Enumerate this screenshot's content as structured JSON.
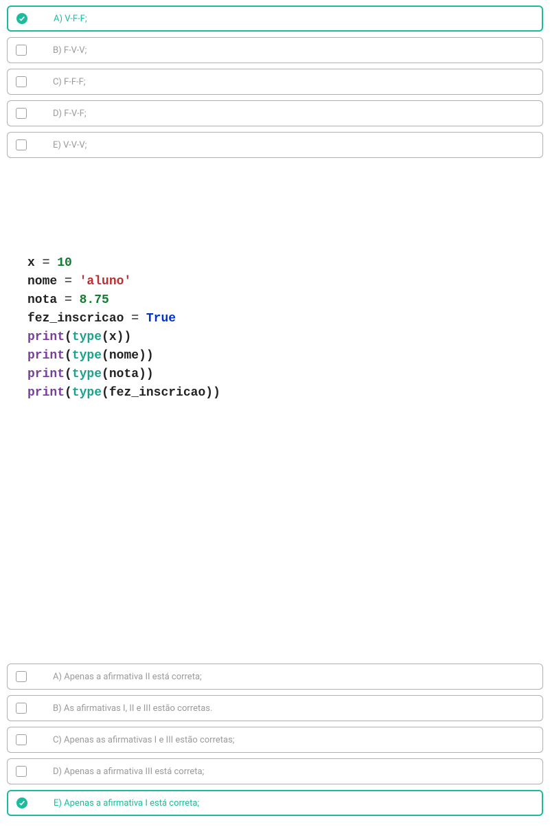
{
  "question1": {
    "options": [
      {
        "label": "A) V-F-F;",
        "selected": true
      },
      {
        "label": "B) F-V-V;",
        "selected": false
      },
      {
        "label": "C) F-F-F;",
        "selected": false
      },
      {
        "label": "D) F-V-F;",
        "selected": false
      },
      {
        "label": "E) V-V-V;",
        "selected": false
      }
    ]
  },
  "code": {
    "line1_var": "x",
    "line1_op": " = ",
    "line1_val": "10",
    "line2_var": "nome",
    "line2_op": " = ",
    "line2_val": "'aluno'",
    "line3_var": "nota",
    "line3_op": " = ",
    "line3_val": "8.75",
    "line4_var": "fez_inscricao",
    "line4_op": " = ",
    "line4_val": "True",
    "print": "print",
    "type": "type",
    "lp": "(",
    "rp": ")",
    "arg1": "x",
    "arg2": "nome",
    "arg3": "nota",
    "arg4": "fez_inscricao"
  },
  "question2": {
    "options": [
      {
        "label": "A) Apenas a afirmativa II está correta;",
        "selected": false
      },
      {
        "label": "B) As afirmativas I, II e III estão corretas.",
        "selected": false
      },
      {
        "label": "C) Apenas as afirmativas I e III estão corretas;",
        "selected": false
      },
      {
        "label": "D) Apenas a afirmativa III está correta;",
        "selected": false
      },
      {
        "label": "E) Apenas a afirmativa I está correta;",
        "selected": true
      }
    ]
  }
}
